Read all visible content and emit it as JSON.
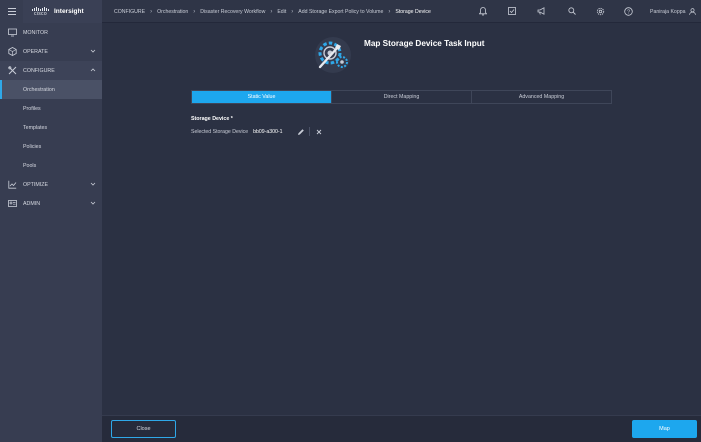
{
  "brand": {
    "logo_text": "cisco",
    "name": "Intersight"
  },
  "breadcrumbs": [
    "CONFIGURE",
    "Orchestration",
    "Disaster Recovery Workflow",
    "Edit",
    "Add Storage Export Policy to Volume",
    "Storage Device"
  ],
  "header": {
    "icons": [
      "bell-icon",
      "checklist-icon",
      "megaphone-icon",
      "search-icon",
      "gear-icon",
      "help-icon"
    ],
    "user_name": "Paniraja Koppa"
  },
  "sidebar": {
    "items": [
      {
        "label": "MONITOR",
        "icon": "monitor-icon"
      },
      {
        "label": "OPERATE",
        "icon": "operate-icon"
      },
      {
        "label": "CONFIGURE",
        "icon": "configure-icon"
      },
      {
        "label": "Orchestration"
      },
      {
        "label": "Profiles"
      },
      {
        "label": "Templates"
      },
      {
        "label": "Policies"
      },
      {
        "label": "Pools"
      },
      {
        "label": "OPTIMIZE",
        "icon": "optimize-icon"
      },
      {
        "label": "ADMIN",
        "icon": "admin-icon"
      }
    ],
    "active_item": "Orchestration"
  },
  "main": {
    "title": "Map Storage Device Task Input",
    "tabs": [
      {
        "label": "Static Value",
        "active": true
      },
      {
        "label": "Direct Mapping",
        "active": false
      },
      {
        "label": "Advanced Mapping",
        "active": false
      }
    ],
    "field": {
      "label": "Storage Device *",
      "selected_label": "Selected Storage Device",
      "selected_value": "bb09-a300-1"
    }
  },
  "footer": {
    "close_label": "Close",
    "map_label": "Map"
  },
  "colors": {
    "accent": "#1da7ee",
    "background": "#2b3143",
    "sidebar": "#373d51"
  }
}
